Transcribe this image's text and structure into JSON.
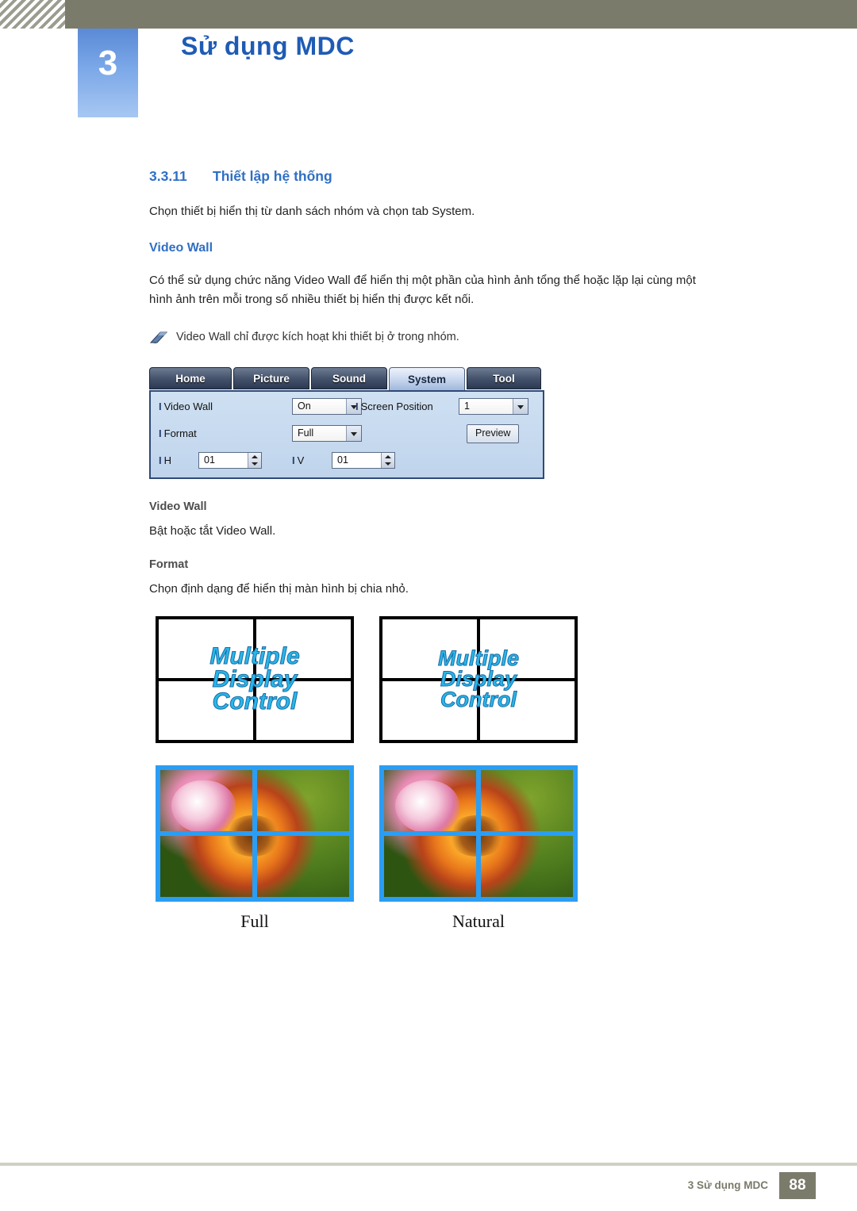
{
  "header": {
    "chapter_number": "3",
    "chapter_title": "Sử dụng MDC"
  },
  "section": {
    "number": "3.3.11",
    "title": "Thiết lập hệ thống",
    "intro": "Chọn thiết bị hiển thị từ danh sách nhóm và chọn tab System.",
    "subheading": "Video Wall",
    "description": "Có thể sử dụng chức năng Video Wall để hiển thị một phần của hình ảnh tổng thể hoặc lặp lại cùng một hình ảnh trên mỗi trong số nhiều thiết bị hiển thị được kết nối.",
    "note": "Video Wall chỉ được kích hoạt khi thiết bị ở trong nhóm.",
    "note_icon": "note-pencil-icon"
  },
  "mdc_panel": {
    "tabs": [
      {
        "label": "Home",
        "active": false
      },
      {
        "label": "Picture",
        "active": false
      },
      {
        "label": "Sound",
        "active": false
      },
      {
        "label": "System",
        "active": true
      },
      {
        "label": "Tool",
        "active": false
      }
    ],
    "fields": {
      "video_wall_label": "Video Wall",
      "video_wall_value": "On",
      "format_label": "Format",
      "format_value": "Full",
      "h_label": "H",
      "h_value": "01",
      "v_label": "V",
      "v_value": "01",
      "screen_position_label": "Screen Position",
      "screen_position_value": "1",
      "preview_button": "Preview"
    }
  },
  "terms": [
    {
      "name": "Video Wall",
      "description": "Bật hoặc tắt Video Wall."
    },
    {
      "name": "Format",
      "description": "Chọn định dạng để hiển thị màn hình bị chia nhỏ."
    }
  ],
  "illustrations": {
    "wall_words": [
      "Multiple",
      "Display",
      "Control"
    ],
    "captions": [
      "Full",
      "Natural"
    ]
  },
  "footer": {
    "label": "3 Sử dụng MDC",
    "page": "88"
  }
}
